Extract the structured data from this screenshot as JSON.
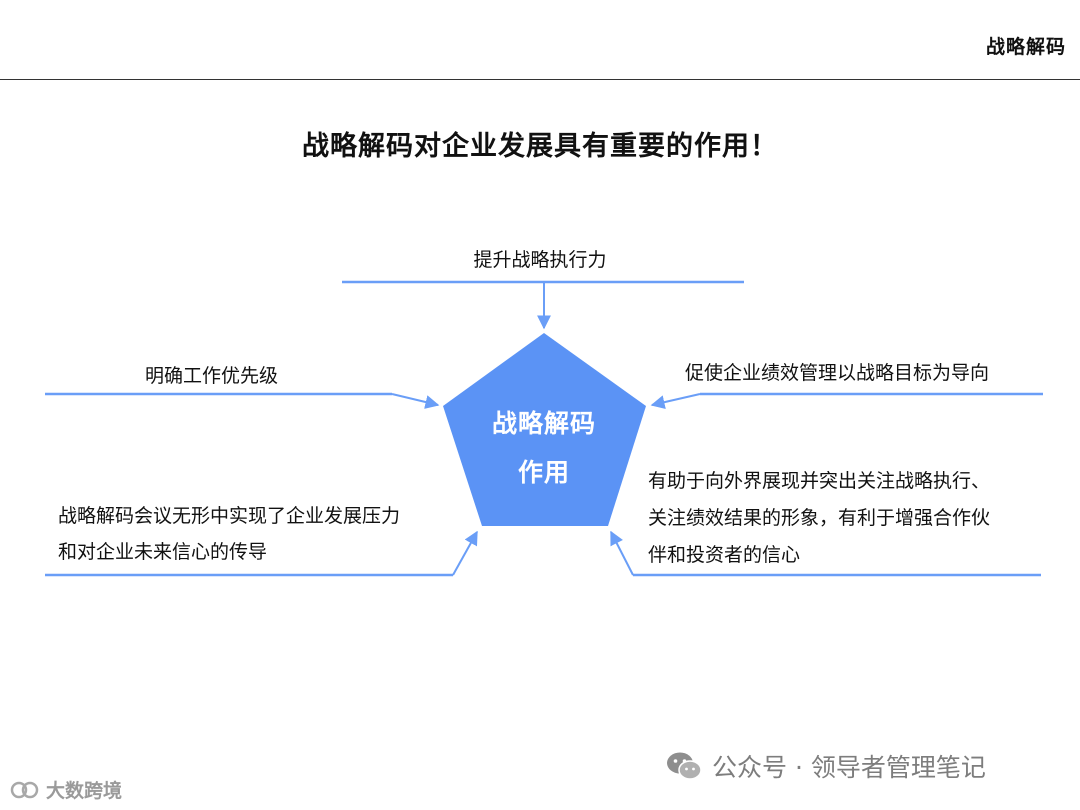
{
  "header": {
    "label": "战略解码"
  },
  "title": "战略解码对企业发展具有重要的作用！",
  "center": {
    "line1": "战略解码",
    "line2": "作用"
  },
  "nodes": {
    "top": "提升战略执行力",
    "left": "明确工作优先级",
    "right": "促使企业绩效管理以战略目标为导向",
    "bottom_left": [
      "战略解码会议无形中实现了企业发展压力",
      "和对企业未来信心的传导"
    ],
    "bottom_right": [
      "有助于向外界展现并突出关注战略执行、",
      "关注绩效结果的形象，有利于增强合作伙",
      "伴和投资者的信心"
    ]
  },
  "watermarks": {
    "wechat": "公众号 · 领导者管理笔记",
    "brand": "大数跨境"
  },
  "colors": {
    "accent": "#5b93f5",
    "line": "#6a9ef7",
    "text": "#111111"
  }
}
